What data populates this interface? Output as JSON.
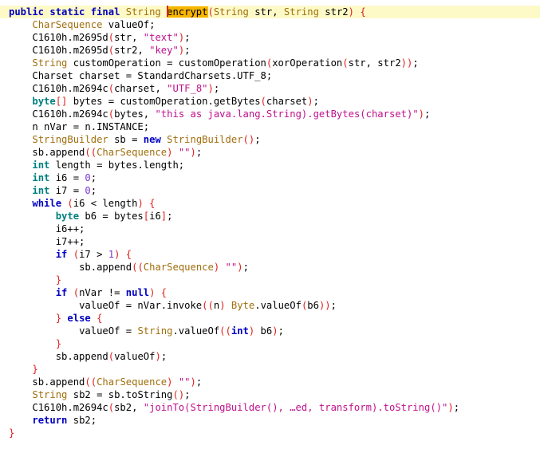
{
  "editor": {
    "language": "java",
    "highlighted_word": "encrypt",
    "current_line": 1,
    "lines": [
      {
        "indent": 0,
        "tokens": [
          [
            "kw",
            "public static final "
          ],
          [
            "type",
            "String "
          ],
          [
            "hl",
            "encrypt"
          ],
          [
            "p",
            "("
          ],
          [
            "type",
            "String "
          ],
          [
            "t",
            "str, "
          ],
          [
            "type",
            "String "
          ],
          [
            "t",
            "str2"
          ],
          [
            "p",
            ") {"
          ]
        ]
      },
      {
        "indent": 1,
        "tokens": [
          [
            "type",
            "CharSequence "
          ],
          [
            "t",
            "valueOf;"
          ]
        ]
      },
      {
        "indent": 1,
        "tokens": [
          [
            "t",
            "C1610h.m2695d"
          ],
          [
            "p",
            "("
          ],
          [
            "t",
            "str, "
          ],
          [
            "str",
            "\"text\""
          ],
          [
            "p",
            ")"
          ],
          [
            "t",
            ";"
          ]
        ]
      },
      {
        "indent": 1,
        "tokens": [
          [
            "t",
            "C1610h.m2695d"
          ],
          [
            "p",
            "("
          ],
          [
            "t",
            "str2, "
          ],
          [
            "str",
            "\"key\""
          ],
          [
            "p",
            ")"
          ],
          [
            "t",
            ";"
          ]
        ]
      },
      {
        "indent": 1,
        "tokens": [
          [
            "type",
            "String "
          ],
          [
            "t",
            "customOperation = customOperation"
          ],
          [
            "p",
            "("
          ],
          [
            "t",
            "xorOperation"
          ],
          [
            "p",
            "("
          ],
          [
            "t",
            "str, str2"
          ],
          [
            "p",
            "))"
          ],
          [
            "t",
            ";"
          ]
        ]
      },
      {
        "indent": 1,
        "tokens": [
          [
            "t",
            "Charset charset = StandardCharsets.UTF_8;"
          ]
        ]
      },
      {
        "indent": 1,
        "tokens": [
          [
            "t",
            "C1610h.m2694c"
          ],
          [
            "p",
            "("
          ],
          [
            "t",
            "charset, "
          ],
          [
            "str",
            "\"UTF_8\""
          ],
          [
            "p",
            ")"
          ],
          [
            "t",
            ";"
          ]
        ]
      },
      {
        "indent": 1,
        "tokens": [
          [
            "kw2",
            "byte"
          ],
          [
            "p",
            "[]"
          ],
          [
            "t",
            " bytes = customOperation.getBytes"
          ],
          [
            "p",
            "("
          ],
          [
            "t",
            "charset"
          ],
          [
            "p",
            ")"
          ],
          [
            "t",
            ";"
          ]
        ]
      },
      {
        "indent": 1,
        "tokens": [
          [
            "t",
            "C1610h.m2694c"
          ],
          [
            "p",
            "("
          ],
          [
            "t",
            "bytes, "
          ],
          [
            "str",
            "\"this as java.lang.String).getBytes(charset)\""
          ],
          [
            "p",
            ")"
          ],
          [
            "t",
            ";"
          ]
        ]
      },
      {
        "indent": 1,
        "tokens": [
          [
            "t",
            "n nVar = n.INSTANCE;"
          ]
        ]
      },
      {
        "indent": 1,
        "tokens": [
          [
            "type",
            "StringBuilder "
          ],
          [
            "t",
            "sb = "
          ],
          [
            "kw",
            "new "
          ],
          [
            "type",
            "StringBuilder"
          ],
          [
            "p",
            "()"
          ],
          [
            "t",
            ";"
          ]
        ]
      },
      {
        "indent": 1,
        "tokens": [
          [
            "t",
            "sb.append"
          ],
          [
            "p",
            "(("
          ],
          [
            "type",
            "CharSequence"
          ],
          [
            "p",
            ")"
          ],
          [
            "t",
            " "
          ],
          [
            "str",
            "\"\""
          ],
          [
            "p",
            ")"
          ],
          [
            "t",
            ";"
          ]
        ]
      },
      {
        "indent": 1,
        "tokens": [
          [
            "kw2",
            "int "
          ],
          [
            "t",
            "length = bytes.length;"
          ]
        ]
      },
      {
        "indent": 1,
        "tokens": [
          [
            "kw2",
            "int "
          ],
          [
            "t",
            "i6 = "
          ],
          [
            "num",
            "0"
          ],
          [
            "t",
            ";"
          ]
        ]
      },
      {
        "indent": 1,
        "tokens": [
          [
            "kw2",
            "int "
          ],
          [
            "t",
            "i7 = "
          ],
          [
            "num",
            "0"
          ],
          [
            "t",
            ";"
          ]
        ]
      },
      {
        "indent": 1,
        "tokens": [
          [
            "kw",
            "while "
          ],
          [
            "p",
            "("
          ],
          [
            "t",
            "i6 < length"
          ],
          [
            "p",
            ") {"
          ]
        ]
      },
      {
        "indent": 2,
        "tokens": [
          [
            "kw2",
            "byte "
          ],
          [
            "t",
            "b6 = bytes"
          ],
          [
            "p",
            "["
          ],
          [
            "t",
            "i6"
          ],
          [
            "p",
            "]"
          ],
          [
            "t",
            ";"
          ]
        ]
      },
      {
        "indent": 2,
        "tokens": [
          [
            "t",
            "i6++;"
          ]
        ]
      },
      {
        "indent": 2,
        "tokens": [
          [
            "t",
            "i7++;"
          ]
        ]
      },
      {
        "indent": 2,
        "tokens": [
          [
            "kw",
            "if "
          ],
          [
            "p",
            "("
          ],
          [
            "t",
            "i7 > "
          ],
          [
            "num",
            "1"
          ],
          [
            "p",
            ") {"
          ]
        ]
      },
      {
        "indent": 3,
        "tokens": [
          [
            "t",
            "sb.append"
          ],
          [
            "p",
            "(("
          ],
          [
            "type",
            "CharSequence"
          ],
          [
            "p",
            ")"
          ],
          [
            "t",
            " "
          ],
          [
            "str",
            "\"\""
          ],
          [
            "p",
            ")"
          ],
          [
            "t",
            ";"
          ]
        ]
      },
      {
        "indent": 2,
        "tokens": [
          [
            "p",
            "}"
          ]
        ]
      },
      {
        "indent": 2,
        "tokens": [
          [
            "kw",
            "if "
          ],
          [
            "p",
            "("
          ],
          [
            "t",
            "nVar != "
          ],
          [
            "kw",
            "null"
          ],
          [
            "p",
            ") {"
          ]
        ]
      },
      {
        "indent": 3,
        "tokens": [
          [
            "t",
            "valueOf = nVar.invoke"
          ],
          [
            "p",
            "(("
          ],
          [
            "t",
            "n"
          ],
          [
            "p",
            ")"
          ],
          [
            "t",
            " "
          ],
          [
            "type",
            "Byte"
          ],
          [
            "t",
            ".valueOf"
          ],
          [
            "p",
            "("
          ],
          [
            "t",
            "b6"
          ],
          [
            "p",
            "))"
          ],
          [
            "t",
            ";"
          ]
        ]
      },
      {
        "indent": 2,
        "tokens": [
          [
            "p",
            "} "
          ],
          [
            "kw",
            "else "
          ],
          [
            "p",
            "{"
          ]
        ]
      },
      {
        "indent": 3,
        "tokens": [
          [
            "t",
            "valueOf = "
          ],
          [
            "type",
            "String"
          ],
          [
            "t",
            ".valueOf"
          ],
          [
            "p",
            "(("
          ],
          [
            "kw",
            "int"
          ],
          [
            "p",
            ")"
          ],
          [
            "t",
            " b6"
          ],
          [
            "p",
            ")"
          ],
          [
            "t",
            ";"
          ]
        ]
      },
      {
        "indent": 2,
        "tokens": [
          [
            "p",
            "}"
          ]
        ]
      },
      {
        "indent": 2,
        "tokens": [
          [
            "t",
            "sb.append"
          ],
          [
            "p",
            "("
          ],
          [
            "t",
            "valueOf"
          ],
          [
            "p",
            ")"
          ],
          [
            "t",
            ";"
          ]
        ]
      },
      {
        "indent": 1,
        "tokens": [
          [
            "p",
            "}"
          ]
        ]
      },
      {
        "indent": 1,
        "tokens": [
          [
            "t",
            "sb.append"
          ],
          [
            "p",
            "(("
          ],
          [
            "type",
            "CharSequence"
          ],
          [
            "p",
            ")"
          ],
          [
            "t",
            " "
          ],
          [
            "str",
            "\"\""
          ],
          [
            "p",
            ")"
          ],
          [
            "t",
            ";"
          ]
        ]
      },
      {
        "indent": 1,
        "tokens": [
          [
            "type",
            "String "
          ],
          [
            "t",
            "sb2 = sb.toString"
          ],
          [
            "p",
            "()"
          ],
          [
            "t",
            ";"
          ]
        ]
      },
      {
        "indent": 1,
        "tokens": [
          [
            "t",
            "C1610h.m2694c"
          ],
          [
            "p",
            "("
          ],
          [
            "t",
            "sb2, "
          ],
          [
            "str",
            "\"joinTo(StringBuilder(), …ed, transform).toString()\""
          ],
          [
            "p",
            ")"
          ],
          [
            "t",
            ";"
          ]
        ]
      },
      {
        "indent": 1,
        "tokens": [
          [
            "kw",
            "return "
          ],
          [
            "t",
            "sb2;"
          ]
        ]
      },
      {
        "indent": 0,
        "tokens": [
          [
            "p",
            "}"
          ]
        ]
      }
    ]
  }
}
